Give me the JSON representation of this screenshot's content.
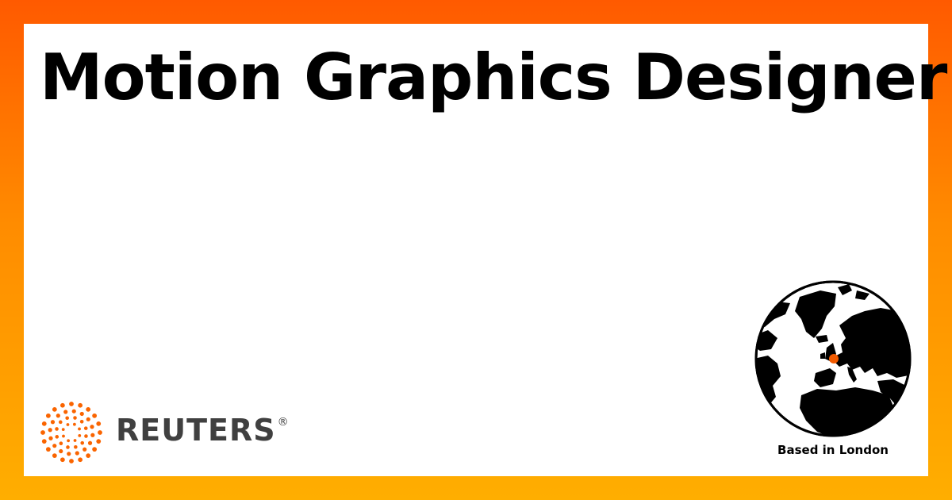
{
  "job": {
    "title": "Motion Graphics Designer"
  },
  "brand": {
    "name": "REUTERS",
    "registered_mark": "®",
    "logo_icon": "reuters-dot-ring-icon",
    "accent_color": "#fa6400",
    "wordmark_color": "#404040"
  },
  "location": {
    "label": "Based in London",
    "globe_icon": "globe-europe-icon",
    "marker_color": "#f25a00"
  },
  "background": {
    "gradient_top": "#ff5a00",
    "gradient_bottom": "#ffae00",
    "card": "#ffffff"
  }
}
